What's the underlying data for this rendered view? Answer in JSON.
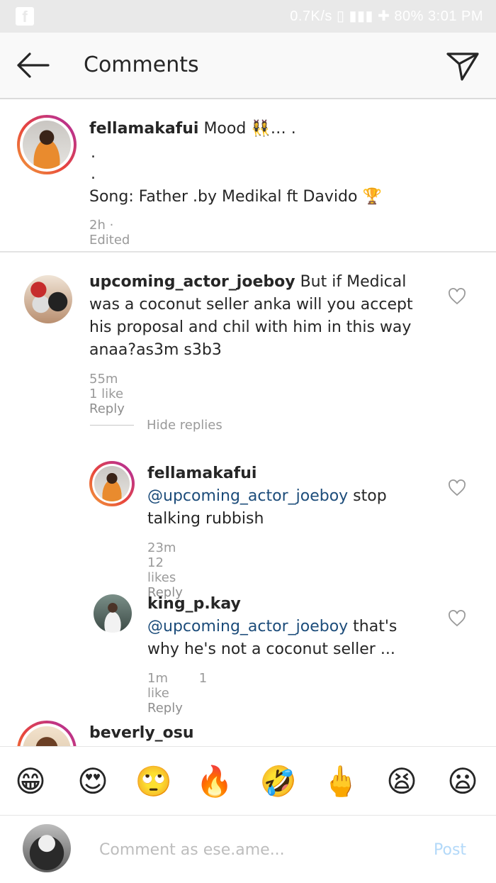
{
  "statusbar": {
    "right_text": "0.7K/s  ▯  ▮▮▮  ✚  80%  3:01 PM",
    "fb_glyph": "f"
  },
  "header": {
    "title": "Comments"
  },
  "caption": {
    "username": "fellamakafui",
    "text_line1": " Mood 👯‍♀️… .",
    "dot1": ".",
    "dot2": ".",
    "text_line2": "Song: Father .by Medikal ft Davido 🏆",
    "meta": "2h · Edited"
  },
  "comments": [
    {
      "username": "upcoming_actor_joeboy",
      "text": " But if Medical was a coconut seller anka will you accept his proposal and chil with him in this way anaa?as3m s3b3",
      "time": "55m",
      "likes": "1 like",
      "reply": "Reply"
    }
  ],
  "hide_replies": "Hide replies",
  "replies": [
    {
      "username": "fellamakafui",
      "mention": "@upcoming_actor_joeboy",
      "text": " stop talking rubbish",
      "time": "23m",
      "likes": "12 likes",
      "reply": "Reply"
    },
    {
      "username": "king_p.kay",
      "mention": "@upcoming_actor_joeboy",
      "text": " that's why he's not a coconut seller ...",
      "time": "1m",
      "likes": "1 like",
      "reply": "Reply"
    }
  ],
  "partial_comment": {
    "username": "beverly_osu",
    "emoji": "🙂"
  },
  "emoji_bar": [
    "😁",
    "😍",
    "🙄",
    "🔥",
    "🤣",
    "🖕",
    "😫",
    "😦"
  ],
  "compose": {
    "placeholder": "Comment as ese.ame...",
    "post_label": "Post"
  }
}
